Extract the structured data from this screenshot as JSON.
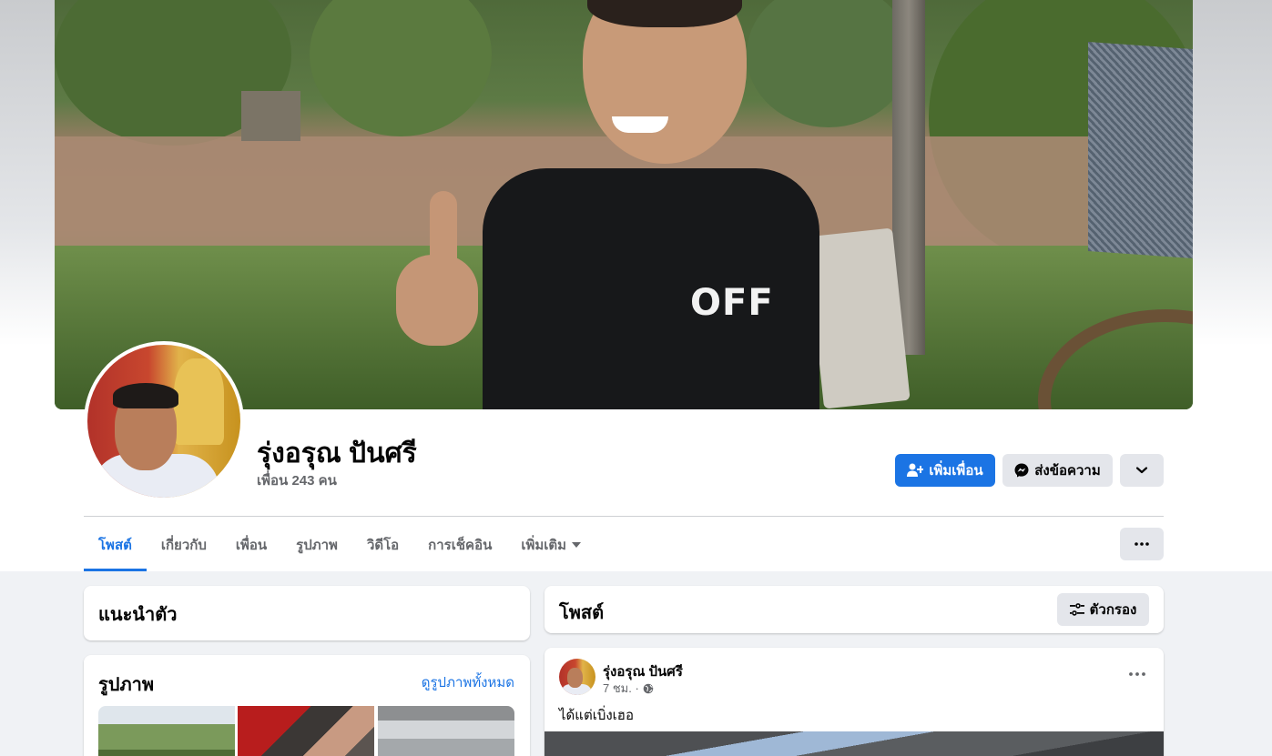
{
  "profile": {
    "name": "รุ่งอรุณ ปันศรี",
    "friends": "เพื่อน 243 คน"
  },
  "cover": {
    "shirt_text": "OFF"
  },
  "actions": {
    "add_friend": "เพิ่มเพื่อน",
    "message": "ส่งข้อความ"
  },
  "tabs": [
    {
      "label": "โพสต์",
      "active": true
    },
    {
      "label": "เกี่ยวกับ"
    },
    {
      "label": "เพื่อน"
    },
    {
      "label": "รูปภาพ"
    },
    {
      "label": "วิดีโอ"
    },
    {
      "label": "การเช็คอิน"
    },
    {
      "label": "เพิ่มเติม"
    }
  ],
  "intro": {
    "title": "แนะนำตัว"
  },
  "photos": {
    "title": "รูปภาพ",
    "see_all": "ดูรูปภาพทั้งหมด"
  },
  "posts": {
    "title": "โพสต์",
    "filter_label": "ตัวกรอง"
  },
  "post": {
    "author": "รุ่งอรุณ ปันศรี",
    "time": "7 ชม. ·",
    "text": "ได้แต่เบิ่งเฮอ"
  },
  "colors": {
    "accent": "#1b74e4",
    "secondary_button": "#e4e6eb",
    "page_bg": "#f0f2f5"
  }
}
